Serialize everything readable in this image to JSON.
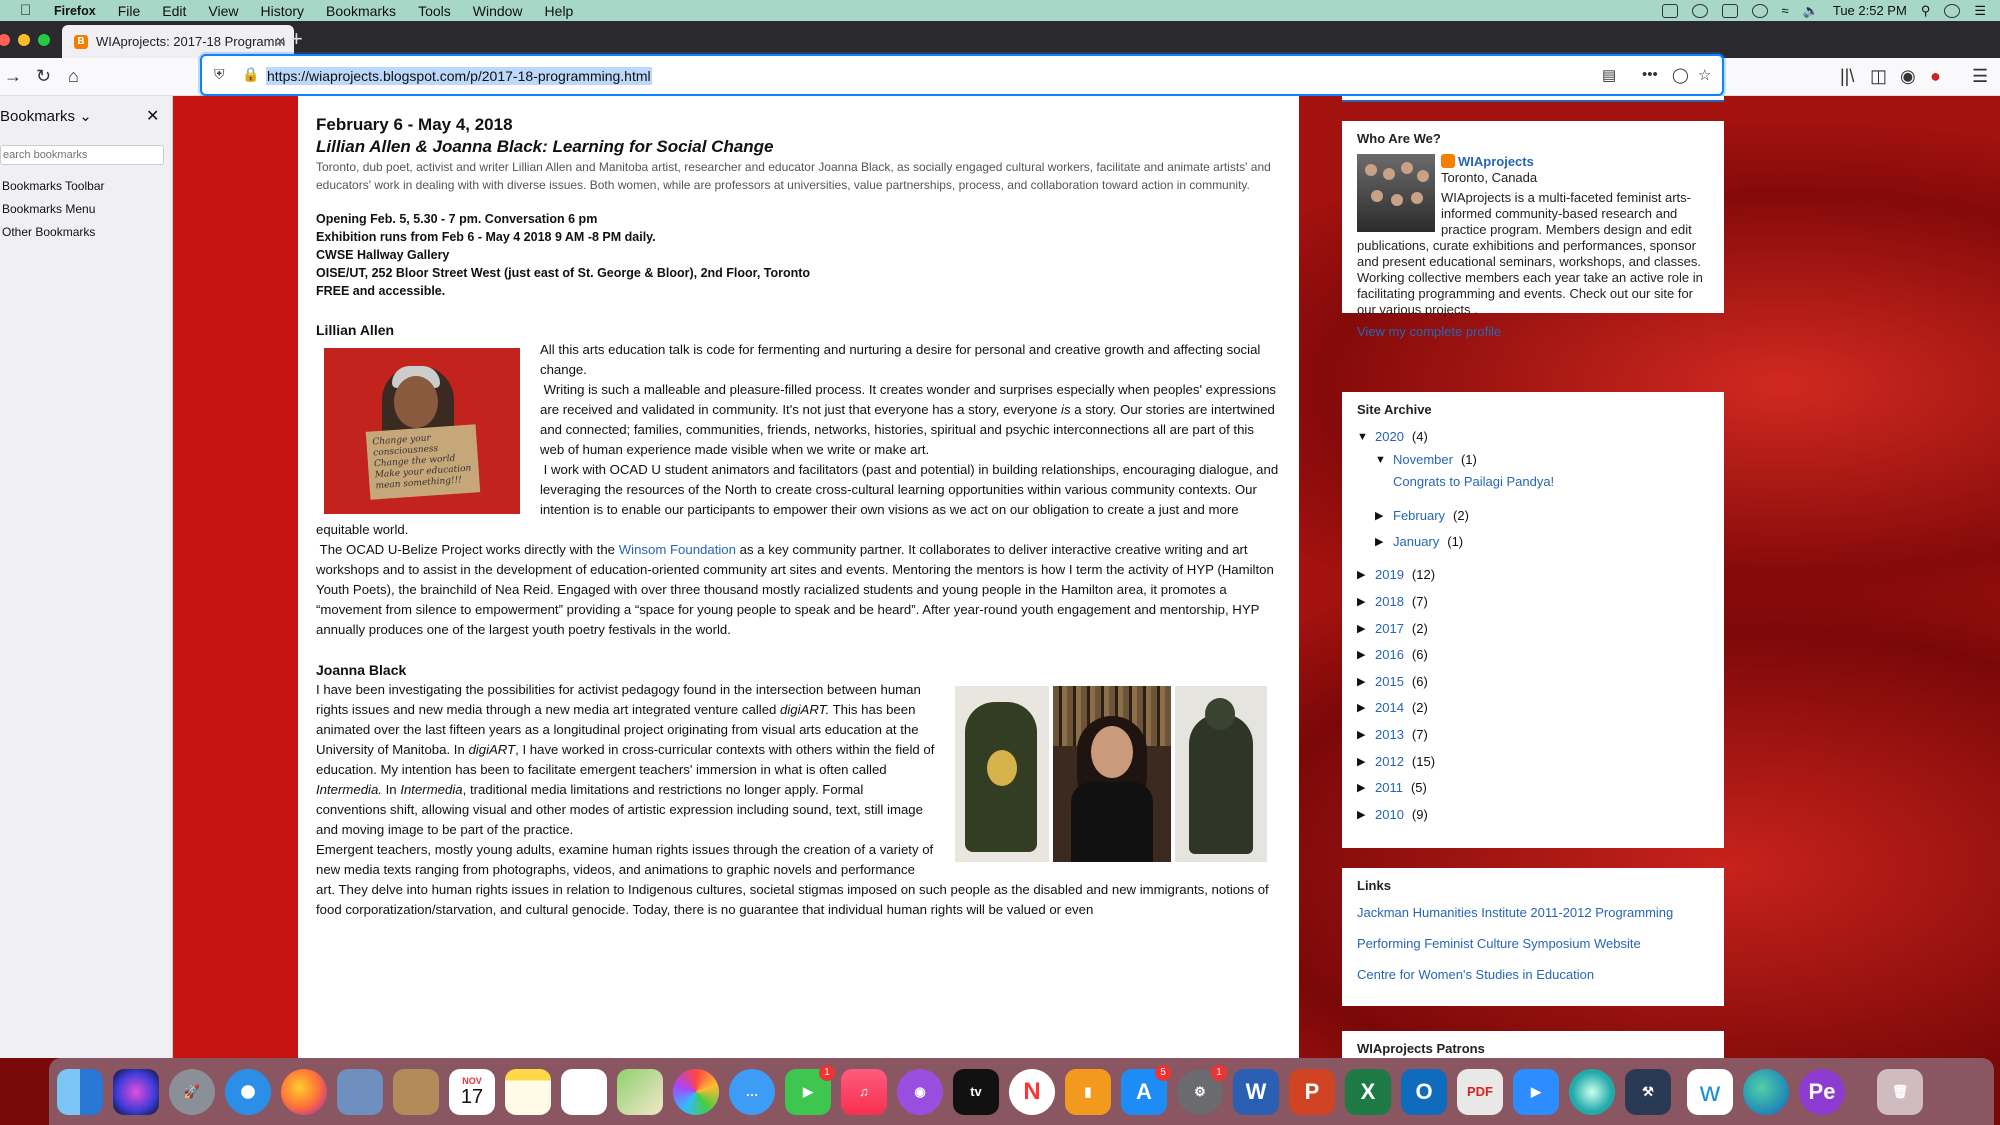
{
  "menubar": {
    "app_name": "Firefox",
    "items": [
      "File",
      "Edit",
      "View",
      "History",
      "Bookmarks",
      "Tools",
      "Window",
      "Help"
    ],
    "clock": "Tue 2:52 PM"
  },
  "browser": {
    "tab_title": "WIAprojects: 2017-18 Programm",
    "url": "https://wiaprojects.blogspot.com/p/2017-18-programming.html"
  },
  "sidebar": {
    "title": "Bookmarks",
    "search_placeholder": "earch bookmarks",
    "items": [
      "Bookmarks Toolbar",
      "Bookmarks Menu",
      "Other Bookmarks"
    ]
  },
  "post": {
    "date_range": "February 6 - May 4, 2018",
    "title": "Lillian Allen & Joanna Black: Learning for Social Change",
    "intro": "Toronto, dub poet, activist and writer Lillian Allen and Manitoba artist, researcher and educator Joanna Black, as socially engaged cultural workers, facilitate and animate artists' and educators' work in dealing with with diverse issues. Both women, while are professors at universities, value partnerships, process, and collaboration toward action in community.",
    "details": [
      "Opening Feb. 5, 5.30 - 7 pm. Conversation 6 pm",
      "Exhibition runs from Feb 6 - May 4 2018 9 AM -8 PM daily.",
      "CWSE Hallway Gallery",
      "OISE/UT, 252 Bloor Street West (just east of St. George & Bloor), 2nd Floor, Toronto",
      "FREE and accessible."
    ],
    "lillian_heading": "Lillian Allen",
    "lillian_p1": "All this arts education talk is code for fermenting and nurturing a desire for personal and creative growth and affecting social change.",
    "lillian_p2a": "Writing is such a malleable and pleasure-filled process. It creates wonder and surprises especially when peoples' expressions are received and validated in community. It's not just that everyone has a story, everyone ",
    "lillian_p2_em": "is",
    "lillian_p2b": " a story. Our stories are intertwined and connected; families, communities, friends, networks, histories, spiritual and psychic interconnections all are part of this web of human experience made visible when we write or make art.",
    "lillian_p3": "I work with OCAD U student animators and facilitators (past and potential) in building relationships, encouraging dialogue, and leveraging the resources of the North to create cross-cultural learning opportunities within various community contexts. Our intention is to enable our participants to empower their own visions as we act on our obligation to create a just and more equitable world.",
    "lillian_p4a": "The OCAD U-Belize Project works directly with the ",
    "lillian_p4_link": "Winsom Foundation",
    "lillian_p4b": " as a key community partner. It collaborates to deliver interactive creative writing and art workshops and to assist in the development of education-oriented community art sites and events. Mentoring the mentors is how I term the activity of HYP (Hamilton Youth Poets), the brainchild of Nea Reid. Engaged with over three thousand mostly racialized students and young people in the Hamilton area, it promotes a “movement from silence to empowerment” providing a “space for young people to speak and be heard”. After year-round youth engagement and mentorship, HYP annually produces one of the largest youth poetry festivals in the world.",
    "lillian_sign_text": "Change your consciousness Change the world Make your education mean something!!!",
    "joanna_heading": "Joanna Black",
    "joanna_p1a": "I have been investigating the possibilities for activist pedagogy found in the intersection between human rights issues and new media through a new media art integrated venture called ",
    "joanna_p1_em1": "digiART.",
    "joanna_p1b": " This has been animated over the last fifteen years as a longitudinal project originating from visual arts education at the University of Manitoba. In ",
    "joanna_p1_em2": "digiART",
    "joanna_p1c": ", I have worked in cross-curricular contexts with others within the field of education. My intention has been to facilitate emergent teachers' immersion in what is often called ",
    "joanna_p1_em3": "Intermedia.",
    "joanna_p1d": " In ",
    "joanna_p1_em4": "Intermedia",
    "joanna_p1e": ", traditional media limitations and restrictions no longer apply. Formal conventions shift, allowing visual and other modes of artistic expression including sound, text, still image and moving image to be part of the practice.",
    "joanna_p2": "Emergent teachers, mostly young adults, examine human rights issues through the creation of a variety of new media texts ranging from photographs, videos, and animations to graphic novels and performance art. They delve into human rights issues in relation to Indigenous cultures, societal stigmas imposed on such people as the disabled and new immigrants, notions of food corporatization/starvation, and cultural genocide. Today, there is no guarantee that individual human rights will be valued or even"
  },
  "profile": {
    "title": "Who Are We?",
    "name": "WIAprojects",
    "location": "Toronto, Canada",
    "description": "WIAprojects is a multi-faceted feminist arts-informed community-based research and practice program. Members design and edit publications, curate exhibitions and performances, sponsor and present educational seminars, workshops, and classes. Working collective members each year take an active role in facilitating programming and events. Check out our site for our various projects .",
    "profile_link": "View my complete profile"
  },
  "archive": {
    "title": "Site Archive",
    "expanded": {
      "year": "2020",
      "count": "(4)",
      "month": "November",
      "month_count": "(1)",
      "post": "Congrats to Pailagi Pandya!"
    },
    "months": [
      {
        "name": "February",
        "count": "(2)"
      },
      {
        "name": "January",
        "count": "(1)"
      }
    ],
    "years": [
      {
        "year": "2019",
        "count": "(12)"
      },
      {
        "year": "2018",
        "count": "(7)"
      },
      {
        "year": "2017",
        "count": "(2)"
      },
      {
        "year": "2016",
        "count": "(6)"
      },
      {
        "year": "2015",
        "count": "(6)"
      },
      {
        "year": "2014",
        "count": "(2)"
      },
      {
        "year": "2013",
        "count": "(7)"
      },
      {
        "year": "2012",
        "count": "(15)"
      },
      {
        "year": "2011",
        "count": "(5)"
      },
      {
        "year": "2010",
        "count": "(9)"
      }
    ]
  },
  "links": {
    "title": "Links",
    "items": [
      "Jackman Humanities Institute 2011-2012 Programming",
      "Performing Feminist Culture Symposium Website",
      "Centre for Women's Studies in Education"
    ]
  },
  "patrons": {
    "title": "WIAprojects Patrons"
  },
  "dock": {
    "calendar_month": "NOV",
    "calendar_day": "17",
    "badges": {
      "facetime": "1",
      "appstore": "5",
      "settings": "1"
    },
    "apps": [
      "Finder",
      "Siri",
      "Launchpad",
      "Safari",
      "Firefox",
      "Preview",
      "Contacts",
      "Calendar",
      "Notes",
      "Reminders",
      "Maps",
      "Photos",
      "Messages",
      "FaceTime",
      "Music",
      "Podcasts",
      "TV",
      "News",
      "Books",
      "App Store",
      "System Preferences",
      "Word",
      "PowerPoint",
      "Excel",
      "Outlook",
      "Acrobat",
      "Zoom",
      "Quicktime",
      "Xcode",
      "Word Online",
      "Edge",
      "Affinity Publisher",
      "Trash"
    ]
  }
}
